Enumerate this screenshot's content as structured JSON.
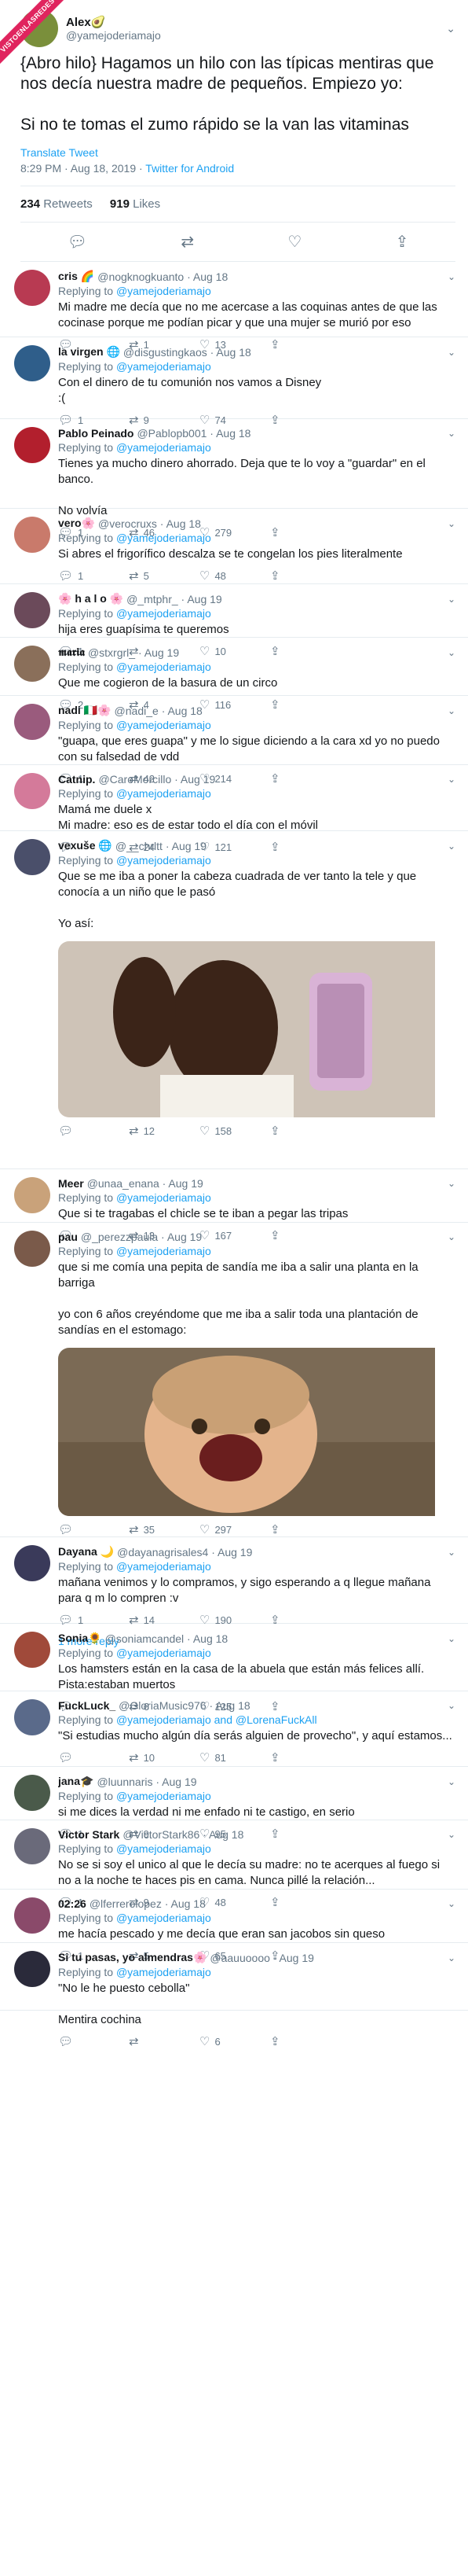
{
  "ribbon": "VISTOENLASREDES",
  "main_tweet": {
    "name": "Alex🥑",
    "handle": "@yamejoderiamajo",
    "text": "{Abro hilo} Hagamos un hilo con las típicas mentiras que nos decía nuestra madre de pequeños. Empiezo yo:\n\nSi no te tomas el zumo rápido se la van las vitaminas",
    "translate": "Translate Tweet",
    "time": "8:29 PM · Aug 18, 2019 · ",
    "source": "Twitter for Android",
    "retweets": "234",
    "retweets_label": "Retweets",
    "likes": "919",
    "likes_label": "Likes",
    "avatar_color": "#7a8f3b"
  },
  "replying_prefix": "Replying to ",
  "replies": [
    {
      "name": "cris 🌈",
      "handle": "@nogknogkuanto · Aug 18",
      "to": "@yamejoderiamajo",
      "text": "Mi madre me decía que no me acercase a las coquinas antes de que las cocinase porque me podían picar y que una mujer se murió por eso",
      "r": "",
      "rt": "1",
      "lk": "13",
      "color": "#b83a52"
    },
    {
      "name": "la virgen 🌐",
      "handle": "@disgustingkaos · Aug 18",
      "to": "@yamejoderiamajo",
      "text": "Con el dinero  de tu comunión nos vamos a Disney\n:(",
      "r": "1",
      "rt": "9",
      "lk": "74",
      "color": "#2f5e8a"
    },
    {
      "name": "Pablo Peinado",
      "handle": "@Pablopb001 · Aug 18",
      "to": "@yamejoderiamajo",
      "text": "Tienes ya mucho dinero ahorrado. Deja que te lo voy a \"guardar\" en el banco.\n\nNo volvía",
      "r": "1",
      "rt": "46",
      "lk": "279",
      "color": "#b21f2d"
    },
    {
      "name": "vero🌸",
      "handle": "@verocruxs · Aug 18",
      "to": "@yamejoderiamajo",
      "text": "Si abres el frigorífico descalza se te congelan los pies literalmente",
      "r": "1",
      "rt": "5",
      "lk": "48",
      "color": "#c97a6b"
    },
    {
      "name": "🌸 h a l o 🌸",
      "handle": "@_mtphr_ · Aug 19",
      "to": "@yamejoderiamajo",
      "text": "hija eres guapísima te queremos",
      "r": "1",
      "rt": "",
      "lk": "10",
      "color": "#6b4a5a"
    },
    {
      "name": "𝖒𝖆𝖗𝖎𝖆",
      "handle": "@stxrgrl_ · Aug 19",
      "to": "@yamejoderiamajo",
      "text": "Que me cogieron de la basura de un circo",
      "r": "2",
      "rt": "4",
      "lk": "116",
      "color": "#8a6f5a"
    },
    {
      "name": "nadi 🇮🇹🌸",
      "handle": "@nadi_e · Aug 18",
      "to": "@yamejoderiamajo",
      "text": "\"guapa, que eres guapa\" y me lo sigue diciendo a la cara xd yo no puedo con su falsedad de vdd",
      "r": "1",
      "rt": "42",
      "lk": "214",
      "color": "#9a5b7d"
    },
    {
      "name": "Catnip.",
      "handle": "@CaroMorcillo · Aug 19",
      "to": "@yamejoderiamajo",
      "text": "Mamá me duele x\nMi madre: eso es de estar todo el día con el móvil",
      "r": "",
      "rt": "24",
      "lk": "121",
      "color": "#d47a9a"
    },
    {
      "name": "vexuše 🌐",
      "handle": "@__chrltt · Aug 19",
      "to": "@yamejoderiamajo",
      "text": "Que se me iba a poner la cabeza cuadrada de ver tanto la tele y que conocía a un niño que le pasó\n\nYo así:",
      "r": "",
      "rt": "12",
      "lk": "158",
      "color": "#4a4f6a",
      "media": "crying-kid"
    },
    {
      "name": "Meer",
      "handle": "@unaa_enana · Aug 19",
      "to": "@yamejoderiamajo",
      "text": "Que si te tragabas el chicle se te iban a pegar las tripas",
      "r": "",
      "rt": "13",
      "lk": "167",
      "color": "#c9a27a"
    },
    {
      "name": "pau",
      "handle": "@_perezzpaula · Aug 19",
      "to": "@yamejoderiamajo",
      "text": "que si me comía una pepita de sandía me iba a salir una planta en la barriga\n\nyo con 6 años creyéndome que me iba a salir toda una plantación de sandías en el estomago:",
      "r": "",
      "rt": "35",
      "lk": "297",
      "color": "#7a5a4a",
      "media": "screaming-kid"
    },
    {
      "name": "Dayana 🌙",
      "handle": "@dayanagrisales4 · Aug 19",
      "to": "@yamejoderiamajo",
      "text": "mañana venimos y lo compramos, y sigo esperando a q llegue mañana para q m lo compren :v",
      "r": "1",
      "rt": "14",
      "lk": "190",
      "color": "#3a3a5a",
      "more": "1 more reply"
    },
    {
      "name": "Sonia🌻",
      "handle": "@soniamcandel · Aug 18",
      "to": "@yamejoderiamajo",
      "text": "Los hamsters están en la casa de la abuela que están más felices allí.\nPista:estaban muertos",
      "r": "",
      "rt": "6",
      "lk": "125",
      "color": "#a04a3a"
    },
    {
      "name": "FuckLuck_",
      "handle": "@GloriaMusic976 · Aug 18",
      "to": "@yamejoderiamajo and @LorenaFuckAll",
      "text": "\"Si estudias mucho algún día serás alguien de provecho\", y aquí estamos...",
      "r": "",
      "rt": "10",
      "lk": "81",
      "color": "#5a6a8a"
    },
    {
      "name": "jana🎓",
      "handle": "@luunnaris · Aug 19",
      "to": "@yamejoderiamajo",
      "text": "si me dices la verdad ni me enfado ni te castigo, en serio",
      "r": "1",
      "rt": "9",
      "lk": "95",
      "color": "#4a5a4a"
    },
    {
      "name": "Victor Stark",
      "handle": "@VictorStark86 · Aug 18",
      "to": "@yamejoderiamajo",
      "text": "No se si soy el unico al que le decía su madre: no te acerques al fuego si no a la noche te haces pis en cama. Nunca pillé la relación...",
      "r": "1",
      "rt": "9",
      "lk": "48",
      "color": "#6a6a7a"
    },
    {
      "name": "02:26",
      "handle": "@lferrerolopez · Aug 18",
      "to": "@yamejoderiamajo",
      "text": "me hacía pescado y me decía que eran san jacobos sin queso",
      "r": "1",
      "rt": "5",
      "lk": "65",
      "color": "#8a4a6a"
    },
    {
      "name": "Si tu pasas, yo almendras🌸",
      "handle": "@aauuoooo · Aug 19",
      "to": "@yamejoderiamajo",
      "text": "\"No le he puesto cebolla\"\n\nMentira cochina",
      "r": "",
      "rt": "",
      "lk": "6",
      "color": "#2a2a3a"
    }
  ]
}
